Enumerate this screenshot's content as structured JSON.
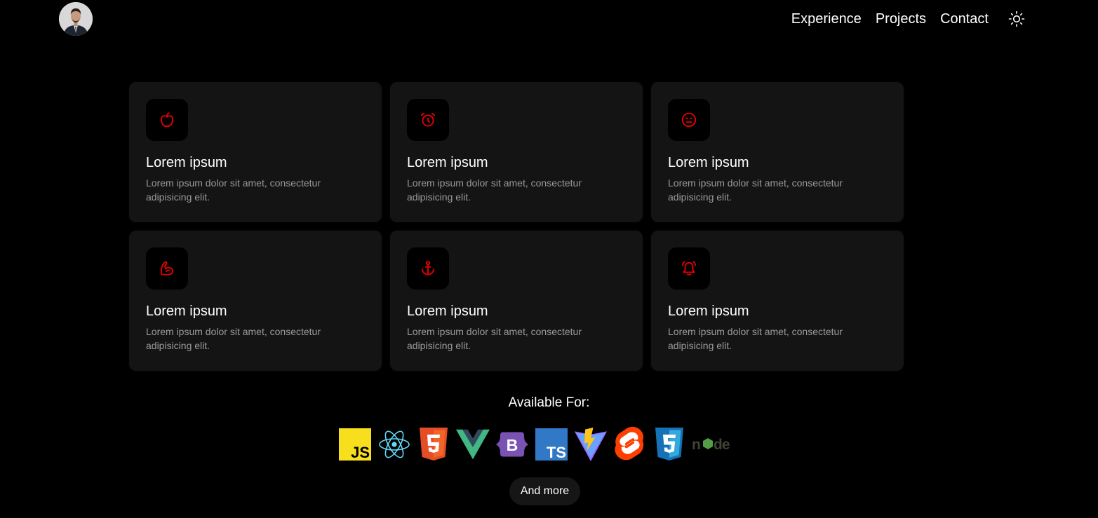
{
  "header": {
    "nav": [
      {
        "label": "Experience"
      },
      {
        "label": "Projects"
      },
      {
        "label": "Contact"
      }
    ],
    "theme_icon": "sun-icon"
  },
  "features": [
    {
      "icon": "apple-icon",
      "title": "Lorem ipsum",
      "desc": "Lorem ipsum dolor sit amet, consectetur adipisicing elit."
    },
    {
      "icon": "alarm-clock-icon",
      "title": "Lorem ipsum",
      "desc": "Lorem ipsum dolor sit amet, consectetur adipisicing elit."
    },
    {
      "icon": "neutral-face-icon",
      "title": "Lorem ipsum",
      "desc": "Lorem ipsum dolor sit amet, consectetur adipisicing elit."
    },
    {
      "icon": "muscle-icon",
      "title": "Lorem ipsum",
      "desc": "Lorem ipsum dolor sit amet, consectetur adipisicing elit."
    },
    {
      "icon": "anchor-icon",
      "title": "Lorem ipsum",
      "desc": "Lorem ipsum dolor sit amet, consectetur adipisicing elit."
    },
    {
      "icon": "bell-ringing-icon",
      "title": "Lorem ipsum",
      "desc": "Lorem ipsum dolor sit amet, consectetur adipisicing elit."
    }
  ],
  "availability": {
    "title": "Available For:",
    "logos": [
      "javascript-logo",
      "react-logo",
      "html5-logo",
      "vue-logo",
      "bootstrap-logo",
      "typescript-logo",
      "vite-logo",
      "svelte-logo",
      "css3-logo",
      "nodejs-logo"
    ],
    "more_label": "And more"
  },
  "colors": {
    "accent": "#e00000",
    "card_bg": "#141414",
    "background": "#000000"
  }
}
